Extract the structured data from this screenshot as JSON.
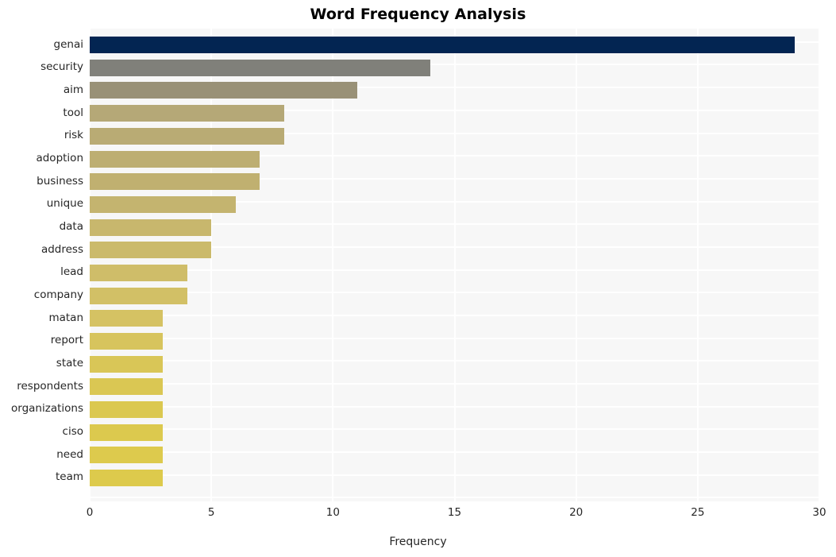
{
  "chart_data": {
    "type": "bar",
    "orientation": "horizontal",
    "title": "Word Frequency Analysis",
    "xlabel": "Frequency",
    "ylabel": "",
    "categories": [
      "genai",
      "security",
      "aim",
      "tool",
      "risk",
      "adoption",
      "business",
      "unique",
      "data",
      "address",
      "lead",
      "company",
      "matan",
      "report",
      "state",
      "respondents",
      "organizations",
      "ciso",
      "need",
      "team"
    ],
    "values": [
      29,
      14,
      11,
      8,
      8,
      7,
      7,
      6,
      5,
      5,
      4,
      4,
      3,
      3,
      3,
      3,
      3,
      3,
      3,
      3
    ],
    "xlim": [
      0,
      30
    ],
    "xticks": [
      0,
      5,
      10,
      15,
      20,
      25,
      30
    ],
    "xtick_labels": [
      "0",
      "5",
      "10",
      "15",
      "20",
      "25",
      "30"
    ],
    "grid": true,
    "legend": false,
    "bar_colors": [
      "#032552",
      "#80807a",
      "#999177",
      "#b5a877",
      "#b9ab74",
      "#bdae72",
      "#c0b070",
      "#c4b46f",
      "#c8b76d",
      "#cbba6b",
      "#cfbd69",
      "#d2c066",
      "#d5c263",
      "#d7c45d",
      "#d9c657",
      "#dac753",
      "#dbc850",
      "#dcc94e",
      "#ddca4d",
      "#ddca4c"
    ],
    "plot_background": "#f7f7f7",
    "grid_color": "#ffffff",
    "figure_background": "#ffffff",
    "text_color": "#262626",
    "title_color": "#000000"
  }
}
